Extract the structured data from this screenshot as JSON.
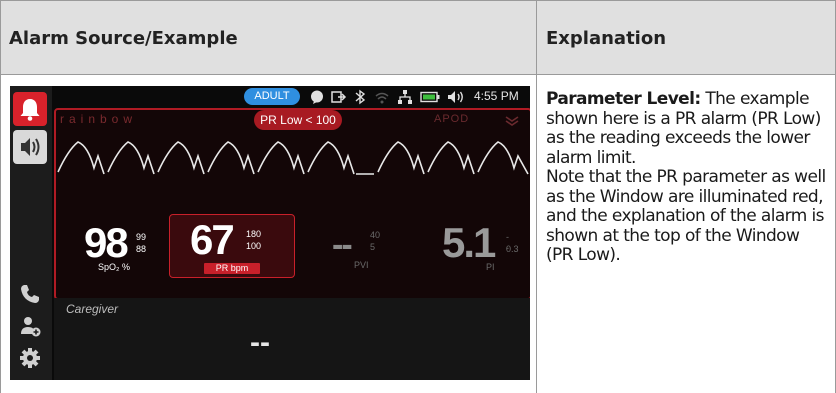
{
  "table": {
    "col1_header": "Alarm Source/Example",
    "col2_header": "Explanation"
  },
  "explanation": {
    "lead": "Parameter Level:",
    "text1": " The example shown here is a PR alarm (PR Low) as the reading exceeds the lower alarm limit.",
    "text2": "Note that the PR parameter as well as the Window are illuminated red, and the explanation of the alarm is shown at the top of the Window (PR Low)."
  },
  "monitor": {
    "status": {
      "mode_badge": "ADULT",
      "time": "4:55 PM"
    },
    "brand": "rainbow",
    "alarm_message": "PR Low < 100",
    "apod_label": "APOD",
    "spo2": {
      "value": "98",
      "high": "99",
      "low": "88",
      "label": "SpO₂ %"
    },
    "pr": {
      "value": "67",
      "high": "180",
      "low": "100",
      "label": "PR bpm"
    },
    "pvi": {
      "value": "--",
      "high": "40",
      "low": "5",
      "label": "PVI"
    },
    "pi": {
      "value": "5.1",
      "high": "--",
      "low": "0.3",
      "label": "PI"
    },
    "caregiver": {
      "label": "Caregiver",
      "value": "--"
    },
    "colors": {
      "alarm_red": "#d8222b",
      "badge_blue": "#2f8fe0"
    },
    "icons": [
      "alarm-bell-icon",
      "speaker-icon",
      "chat-icon",
      "export-icon",
      "bluetooth-icon",
      "wifi-icon",
      "network-icon",
      "battery-icon",
      "volume-icon",
      "phone-icon",
      "add-user-icon",
      "gear-icon"
    ]
  }
}
